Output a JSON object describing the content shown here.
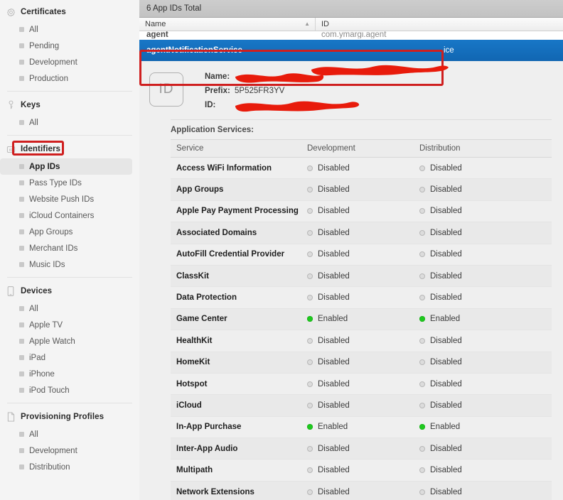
{
  "sidebar": {
    "groups": [
      {
        "title": "Certificates",
        "icon": "certificate-seal-icon",
        "items": [
          {
            "label": "All",
            "selected": false
          },
          {
            "label": "Pending",
            "selected": false
          },
          {
            "label": "Development",
            "selected": false
          },
          {
            "label": "Production",
            "selected": false
          }
        ]
      },
      {
        "title": "Keys",
        "icon": "key-icon",
        "items": [
          {
            "label": "All",
            "selected": false
          }
        ]
      },
      {
        "title": "Identifiers",
        "icon": "identifier-id-icon",
        "items": [
          {
            "label": "App IDs",
            "selected": true
          },
          {
            "label": "Pass Type IDs",
            "selected": false
          },
          {
            "label": "Website Push IDs",
            "selected": false
          },
          {
            "label": "iCloud Containers",
            "selected": false
          },
          {
            "label": "App Groups",
            "selected": false
          },
          {
            "label": "Merchant IDs",
            "selected": false
          },
          {
            "label": "Music IDs",
            "selected": false
          }
        ]
      },
      {
        "title": "Devices",
        "icon": "iphone-device-icon",
        "items": [
          {
            "label": "All",
            "selected": false
          },
          {
            "label": "Apple TV",
            "selected": false
          },
          {
            "label": "Apple Watch",
            "selected": false
          },
          {
            "label": "iPad",
            "selected": false
          },
          {
            "label": "iPhone",
            "selected": false
          },
          {
            "label": "iPod Touch",
            "selected": false
          }
        ]
      },
      {
        "title": "Provisioning Profiles",
        "icon": "document-profile-icon",
        "items": [
          {
            "label": "All",
            "selected": false
          },
          {
            "label": "Development",
            "selected": false
          },
          {
            "label": "Distribution",
            "selected": false
          }
        ]
      }
    ]
  },
  "main": {
    "titlebar": "6 App IDs Total",
    "list": {
      "columns": {
        "name": "Name",
        "id": "ID",
        "sort_indicator": "▲"
      },
      "rows": [
        {
          "name": "agent",
          "id": "com.ymargi.agent",
          "selected": false,
          "partial": true
        },
        {
          "name": "agentNotificationService",
          "id": "ice",
          "selected": true,
          "partial": false
        }
      ]
    },
    "detail": {
      "badge_text": "ID",
      "fields": [
        {
          "label": "Name:",
          "value": "",
          "redacted": true
        },
        {
          "label": "Prefix:",
          "value": "5P525FR3YV",
          "redacted": false
        },
        {
          "label": "ID:",
          "value": "",
          "redacted": true
        }
      ],
      "application_services_label": "Application Services:",
      "services_columns": [
        "Service",
        "Development",
        "Distribution"
      ],
      "status_enabled": "Enabled",
      "status_disabled": "Disabled",
      "services": [
        {
          "name": "Access WiFi Information",
          "development": "Disabled",
          "distribution": "Disabled"
        },
        {
          "name": "App Groups",
          "development": "Disabled",
          "distribution": "Disabled"
        },
        {
          "name": "Apple Pay Payment Processing",
          "development": "Disabled",
          "distribution": "Disabled"
        },
        {
          "name": "Associated Domains",
          "development": "Disabled",
          "distribution": "Disabled"
        },
        {
          "name": "AutoFill Credential Provider",
          "development": "Disabled",
          "distribution": "Disabled"
        },
        {
          "name": "ClassKit",
          "development": "Disabled",
          "distribution": "Disabled"
        },
        {
          "name": "Data Protection",
          "development": "Disabled",
          "distribution": "Disabled"
        },
        {
          "name": "Game Center",
          "development": "Enabled",
          "distribution": "Enabled"
        },
        {
          "name": "HealthKit",
          "development": "Disabled",
          "distribution": "Disabled"
        },
        {
          "name": "HomeKit",
          "development": "Disabled",
          "distribution": "Disabled"
        },
        {
          "name": "Hotspot",
          "development": "Disabled",
          "distribution": "Disabled"
        },
        {
          "name": "iCloud",
          "development": "Disabled",
          "distribution": "Disabled"
        },
        {
          "name": "In-App Purchase",
          "development": "Enabled",
          "distribution": "Enabled"
        },
        {
          "name": "Inter-App Audio",
          "development": "Disabled",
          "distribution": "Disabled"
        },
        {
          "name": "Multipath",
          "development": "Disabled",
          "distribution": "Disabled"
        },
        {
          "name": "Network Extensions",
          "development": "Disabled",
          "distribution": "Disabled"
        }
      ]
    }
  },
  "colors": {
    "selection_blue": "#1877c7",
    "annotation_red": "#cf1f1f",
    "redaction_red": "#e81b0b",
    "enabled_green": "#1ec81e",
    "disabled_gray": "#dcdcdc"
  }
}
